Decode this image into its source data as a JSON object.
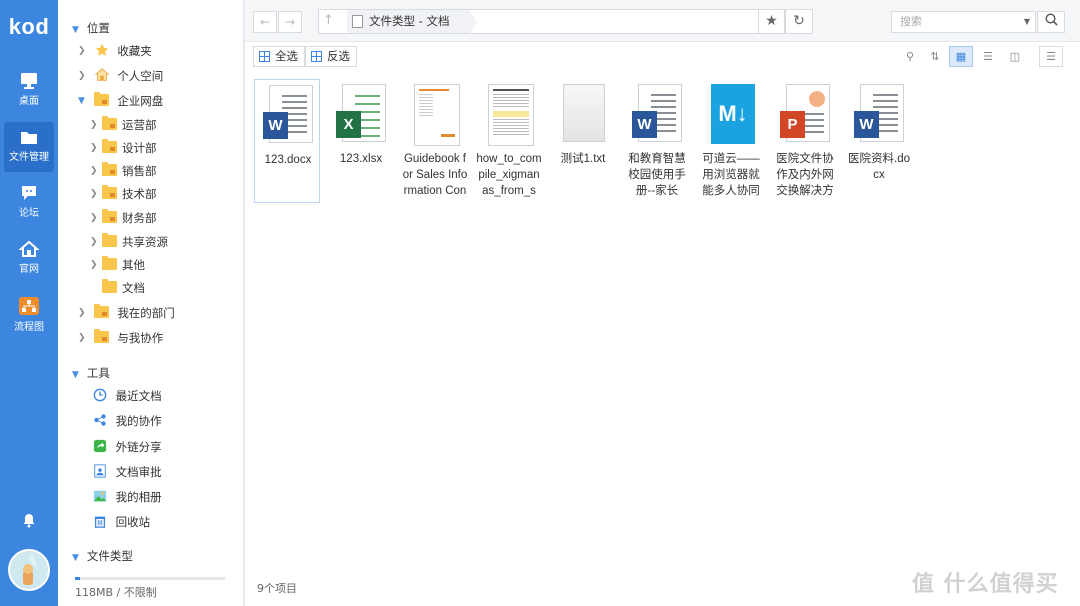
{
  "app": {
    "logo": "kod",
    "accent": "#3d86e0"
  },
  "rail": [
    {
      "label": "桌面",
      "icon": "monitor-icon"
    },
    {
      "label": "文件管理",
      "icon": "folder-icon",
      "active": true
    },
    {
      "label": "论坛",
      "icon": "chat-icon"
    },
    {
      "label": "官网",
      "icon": "home-icon"
    },
    {
      "label": "流程图",
      "icon": "flowchart-icon"
    }
  ],
  "tree": {
    "location_header": "位置",
    "favorites": "收藏夹",
    "personal": "个人空间",
    "enterprise": "企业网盘",
    "departments": [
      "运营部",
      "设计部",
      "销售部",
      "技术部",
      "财务部",
      "共享资源",
      "其他",
      "文档"
    ],
    "my_dept": "我在的部门",
    "collab_with_me": "与我协作",
    "tools_header": "工具",
    "tools": [
      "最近文档",
      "我的协作",
      "外链分享",
      "文档审批",
      "我的相册",
      "回收站"
    ],
    "filetypes_header": "文件类型",
    "quota": "118MB / 不限制",
    "quota_used_fraction": 0.03
  },
  "address": {
    "breadcrumb": "文件类型 - 文档",
    "search_placeholder": "搜索"
  },
  "toolbar": {
    "select_all": "全选",
    "invert": "反选"
  },
  "files": [
    {
      "name": "123.docx",
      "type": "word",
      "selected": true
    },
    {
      "name": "123.xlsx",
      "type": "excel"
    },
    {
      "name": "Guidebook for Sales Information Con",
      "type": "pdf-preview"
    },
    {
      "name": "how_to_compile_xigmanas_from_s",
      "type": "pdf-preview2"
    },
    {
      "name": "测试1.txt",
      "type": "txt"
    },
    {
      "name": "和教育智慧校园使用手册--家长",
      "type": "word"
    },
    {
      "name": "可道云——用浏览器就能多人协同",
      "type": "markdown"
    },
    {
      "name": "医院文件协作及内外网交换解决方",
      "type": "ppt"
    },
    {
      "name": "医院资料.docx",
      "type": "word"
    }
  ],
  "status": {
    "count": "9个项目"
  },
  "watermark": "值 什么值得买"
}
